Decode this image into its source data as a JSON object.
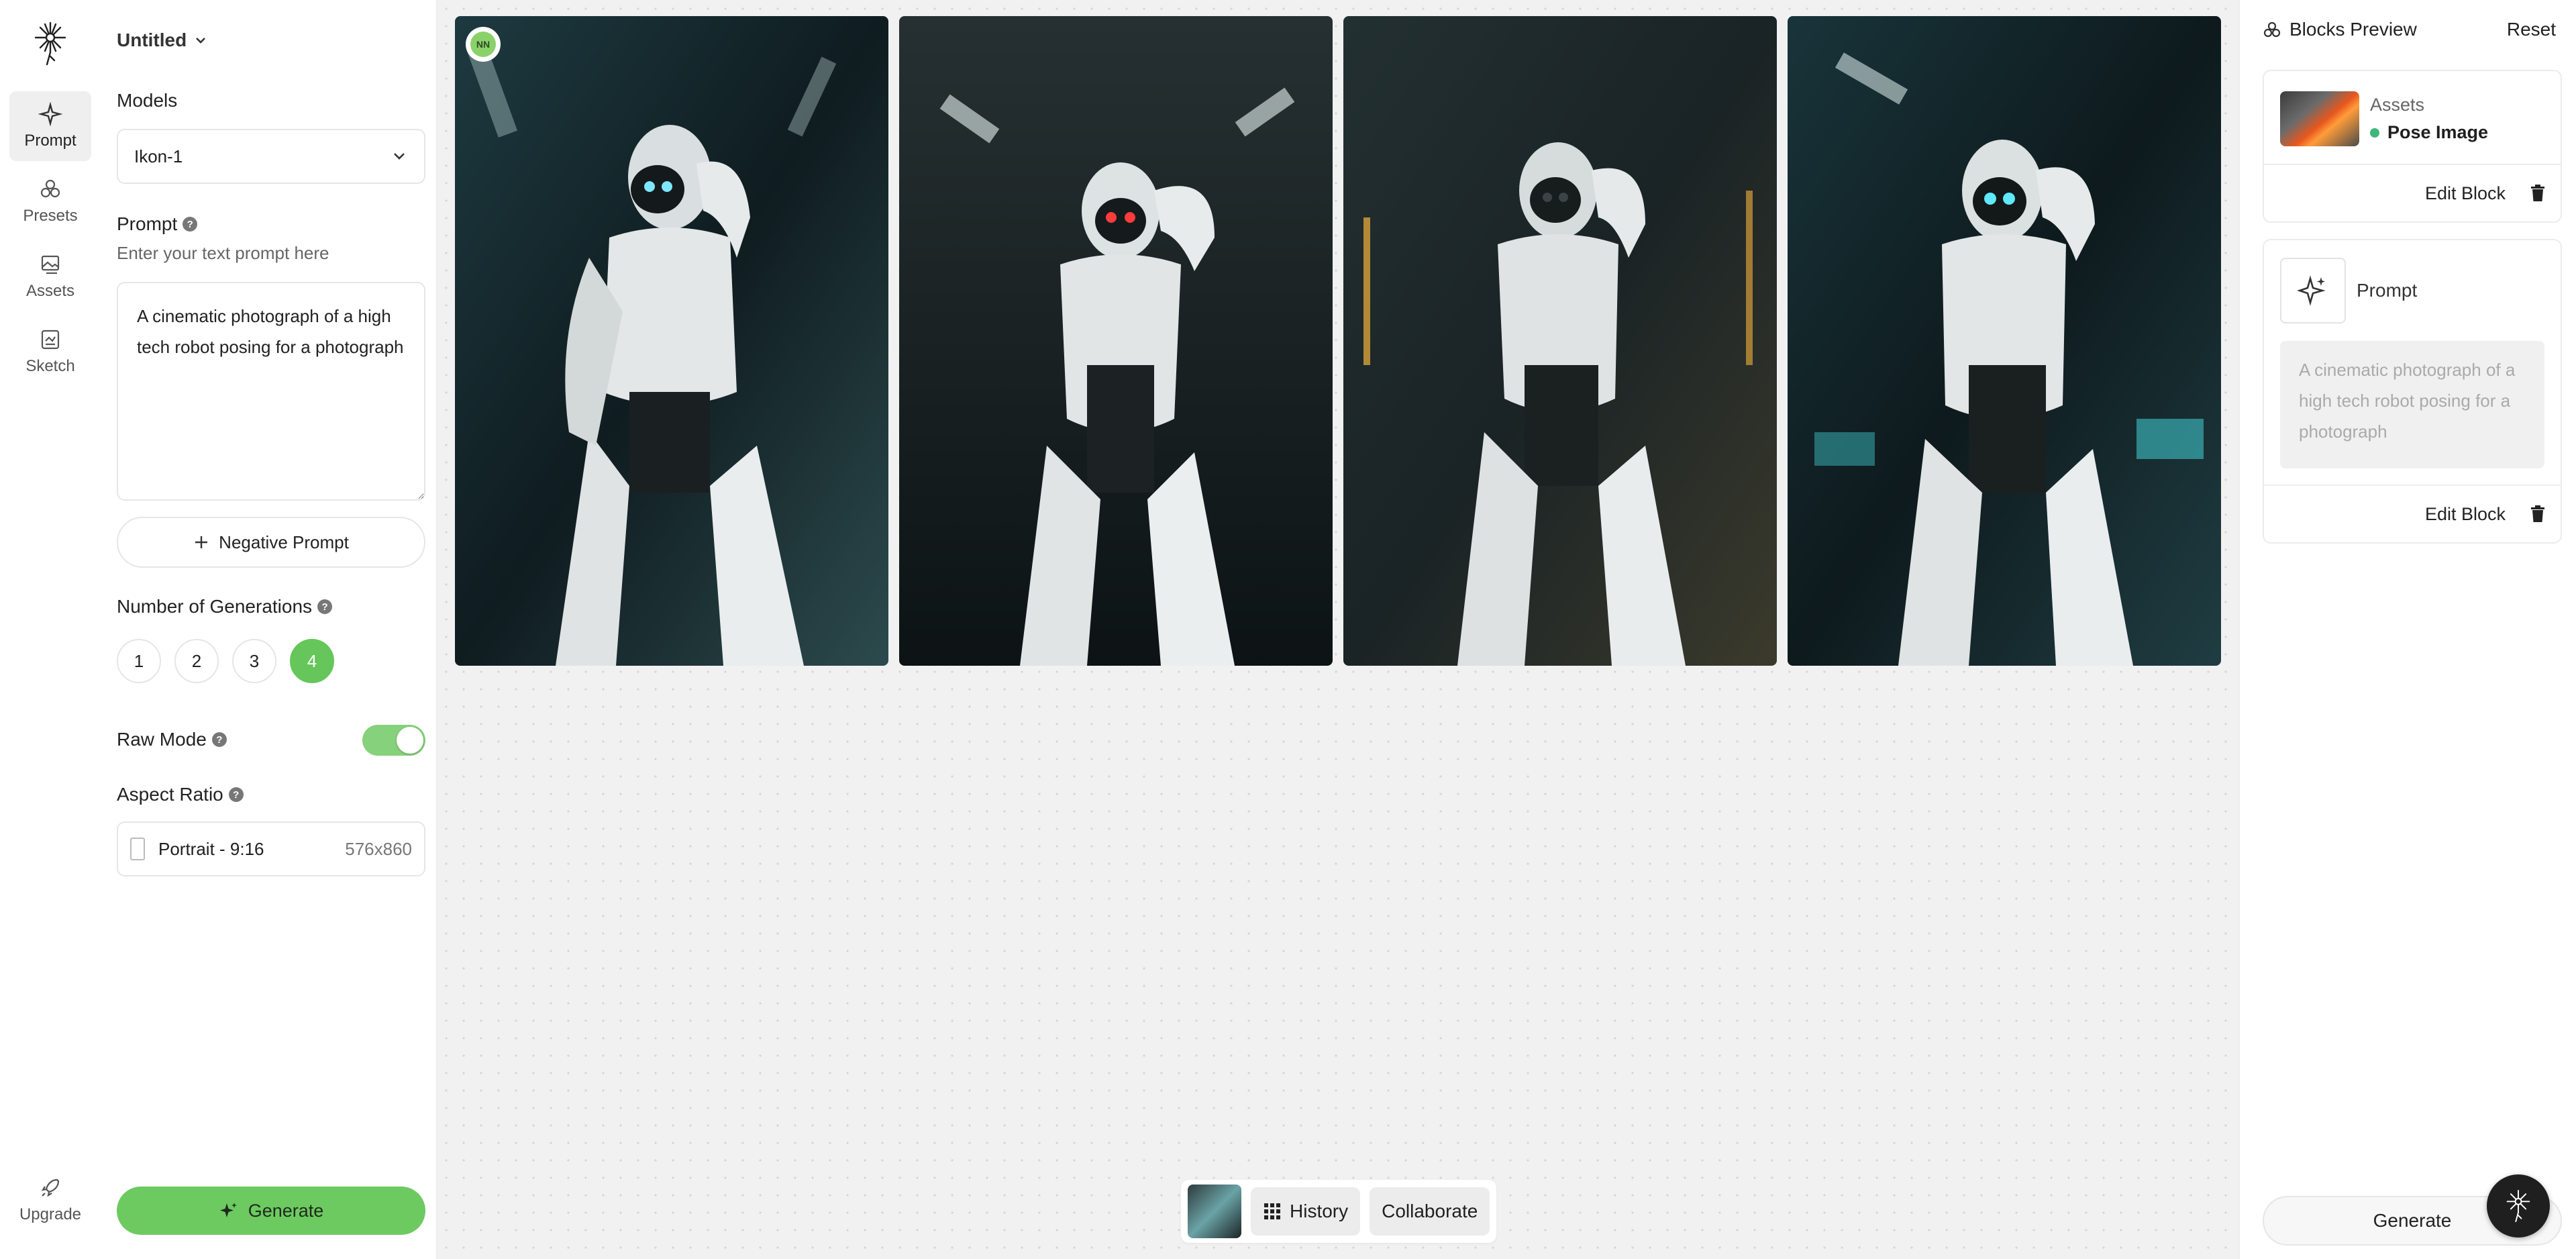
{
  "rail": {
    "items": [
      {
        "label": "Prompt",
        "icon": "sparkle-icon",
        "active": true
      },
      {
        "label": "Presets",
        "icon": "presets-icon"
      },
      {
        "label": "Assets",
        "icon": "assets-icon"
      },
      {
        "label": "Sketch",
        "icon": "sketch-icon"
      }
    ],
    "upgrade": "Upgrade"
  },
  "panel": {
    "title": "Untitled",
    "models_label": "Models",
    "model_value": "Ikon-1",
    "prompt_label": "Prompt",
    "prompt_hint": "Enter your text prompt here",
    "prompt_value": "A cinematic photograph of a high tech robot posing for a photograph",
    "negative_prompt": "Negative Prompt",
    "generations_label": "Number of Generations",
    "generations": [
      "1",
      "2",
      "3",
      "4"
    ],
    "generations_selected": "4",
    "raw_mode_label": "Raw Mode",
    "raw_mode_on": true,
    "aspect_label": "Aspect Ratio",
    "aspect_value": "Portrait - 9:16",
    "aspect_dims": "576x860",
    "generate": "Generate",
    "help_glyph": "?"
  },
  "canvas": {
    "avatar_initials": "NN",
    "bottom_bar": {
      "history": "History",
      "collaborate": "Collaborate"
    }
  },
  "right": {
    "header": "Blocks Preview",
    "reset": "Reset",
    "asset_block": {
      "title": "Assets",
      "item": "Pose Image",
      "edit": "Edit Block"
    },
    "prompt_block": {
      "title": "Prompt",
      "text": "A cinematic photograph of a high tech robot posing for a photograph",
      "edit": "Edit Block"
    },
    "generate": "Generate"
  },
  "colors": {
    "accent": "#6dca60",
    "status_dot": "#3fb67a"
  }
}
